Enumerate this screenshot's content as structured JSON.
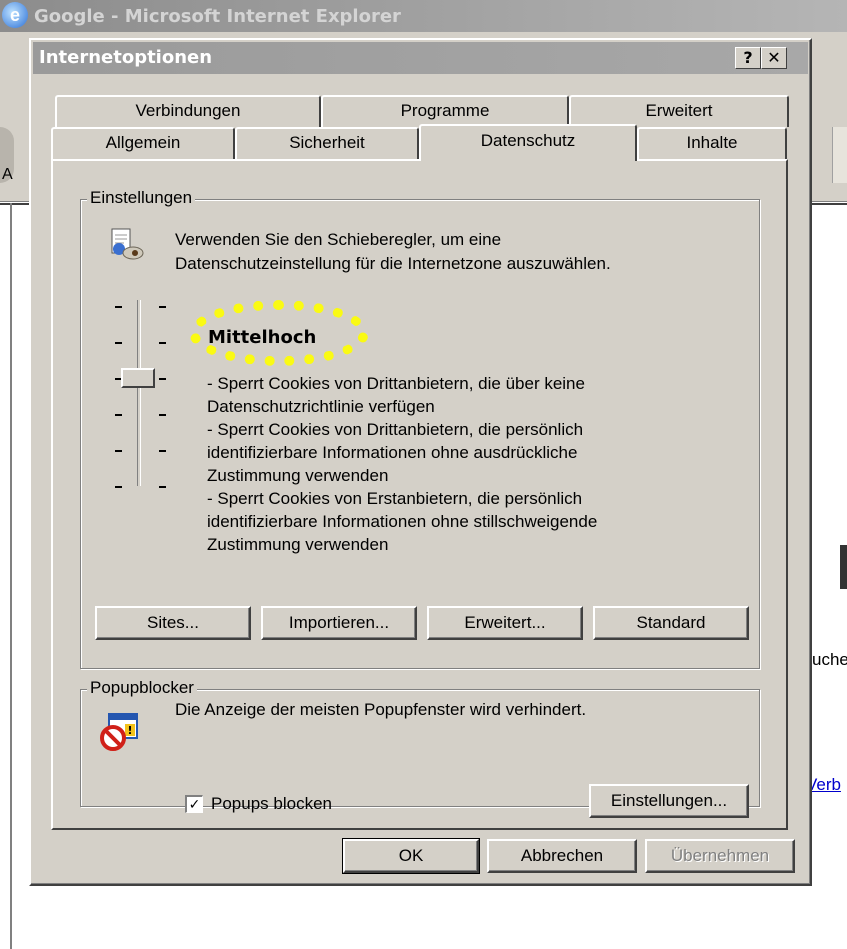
{
  "background_window": {
    "title": "Google - Microsoft Internet Explorer",
    "address_label": "A",
    "partial_text": "uche",
    "partial_link": "Verb"
  },
  "dialog": {
    "title": "Internetoptionen",
    "help_label": "?",
    "close_label": "✕",
    "tabs_row1": [
      "Verbindungen",
      "Programme",
      "Erweitert"
    ],
    "tabs_row2": [
      "Allgemein",
      "Sicherheit",
      "Datenschutz",
      "Inhalte"
    ],
    "active_tab": "Datenschutz",
    "settings_group": {
      "legend": "Einstellungen",
      "instruction_line1": "Verwenden Sie den Schieberegler, um eine",
      "instruction_line2": "Datenschutzeinstellung für die Internetzone auszuwählen.",
      "slider_level_index": 2,
      "slider_levels": 6,
      "level_title": "Mittelhoch",
      "level_description": [
        "- Sperrt Cookies von Drittanbietern, die über keine",
        "Datenschutzrichtlinie verfügen",
        "- Sperrt Cookies von Drittanbietern, die persönlich",
        "identifizierbare Informationen ohne ausdrückliche",
        "Zustimmung verwenden",
        "- Sperrt Cookies von Erstanbietern, die persönlich",
        "identifizierbare Informationen ohne stillschweigende",
        "Zustimmung verwenden"
      ],
      "buttons": {
        "sites": "Sites...",
        "import": "Importieren...",
        "advanced": "Erweitert...",
        "default": "Standard"
      }
    },
    "popup_group": {
      "legend": "Popupblocker",
      "description": "Die Anzeige der meisten Popupfenster wird verhindert.",
      "checkbox_label": "Popups blocken",
      "checkbox_checked": true,
      "settings_button": "Einstellungen..."
    },
    "footer": {
      "ok": "OK",
      "cancel": "Abbrechen",
      "apply": "Übernehmen"
    }
  },
  "colors": {
    "dialog_face": "#d4d0c8",
    "highlight": "#ffff00",
    "link": "#0000cc"
  }
}
